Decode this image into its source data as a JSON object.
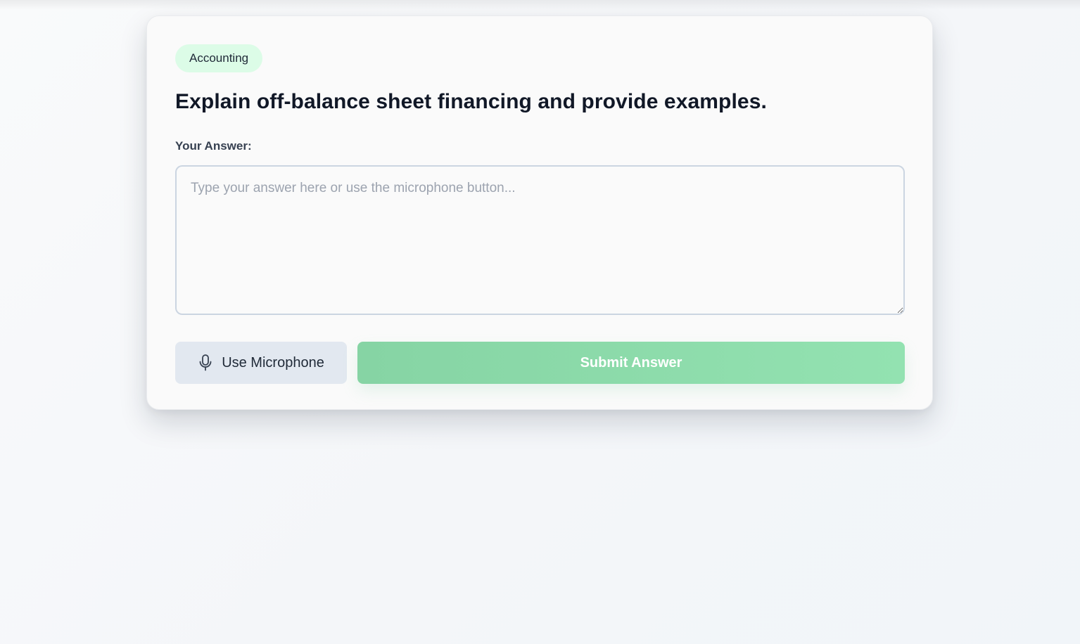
{
  "question_card": {
    "category_badge": "Accounting",
    "question": "Explain off-balance sheet financing and provide examples.",
    "answer_label": "Your Answer:",
    "answer_value": "",
    "answer_placeholder": "Type your answer here or use the microphone button..."
  },
  "actions": {
    "microphone_label": "Use Microphone",
    "microphone_icon": "microphone-icon",
    "submit_label": "Submit Answer"
  },
  "colors": {
    "badge_background": "#dcfce7",
    "submit_accent": "#8ed8aa",
    "microphone_button": "#e2e8f0",
    "heading_text": "#111827"
  }
}
